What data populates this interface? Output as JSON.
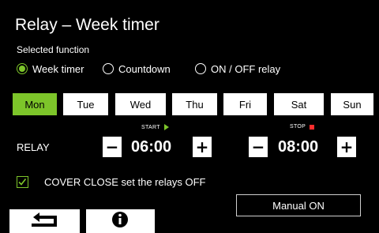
{
  "header": {
    "title": "Relay – Week timer",
    "subtitle": "Selected function"
  },
  "function_options": [
    {
      "label": "Week timer",
      "selected": true
    },
    {
      "label": "Countdown",
      "selected": false
    },
    {
      "label": "ON / OFF relay",
      "selected": false
    }
  ],
  "days": [
    {
      "label": "Mon",
      "active": true
    },
    {
      "label": "Tue",
      "active": false
    },
    {
      "label": "Wed",
      "active": false
    },
    {
      "label": "Thu",
      "active": false
    },
    {
      "label": "Fri",
      "active": false
    },
    {
      "label": "Sat",
      "active": false
    },
    {
      "label": "Sun",
      "active": false
    }
  ],
  "schedule": {
    "row_label": "RELAY",
    "start_caption": "START",
    "stop_caption": "STOP",
    "start_time": "06:00",
    "stop_time": "08:00",
    "minus_symbol": "−",
    "plus_symbol": "+"
  },
  "cover_option": {
    "label": "COVER CLOSE set the relays OFF",
    "checked": true
  },
  "manual_button": {
    "label": "Manual ON"
  },
  "bottom_buttons": {
    "back_icon": "return-arrow-icon",
    "info_icon": "info-icon"
  },
  "colors": {
    "accent": "#7dc52a",
    "stop": "#ff2d2d",
    "background": "#000000",
    "button": "#ffffff"
  }
}
